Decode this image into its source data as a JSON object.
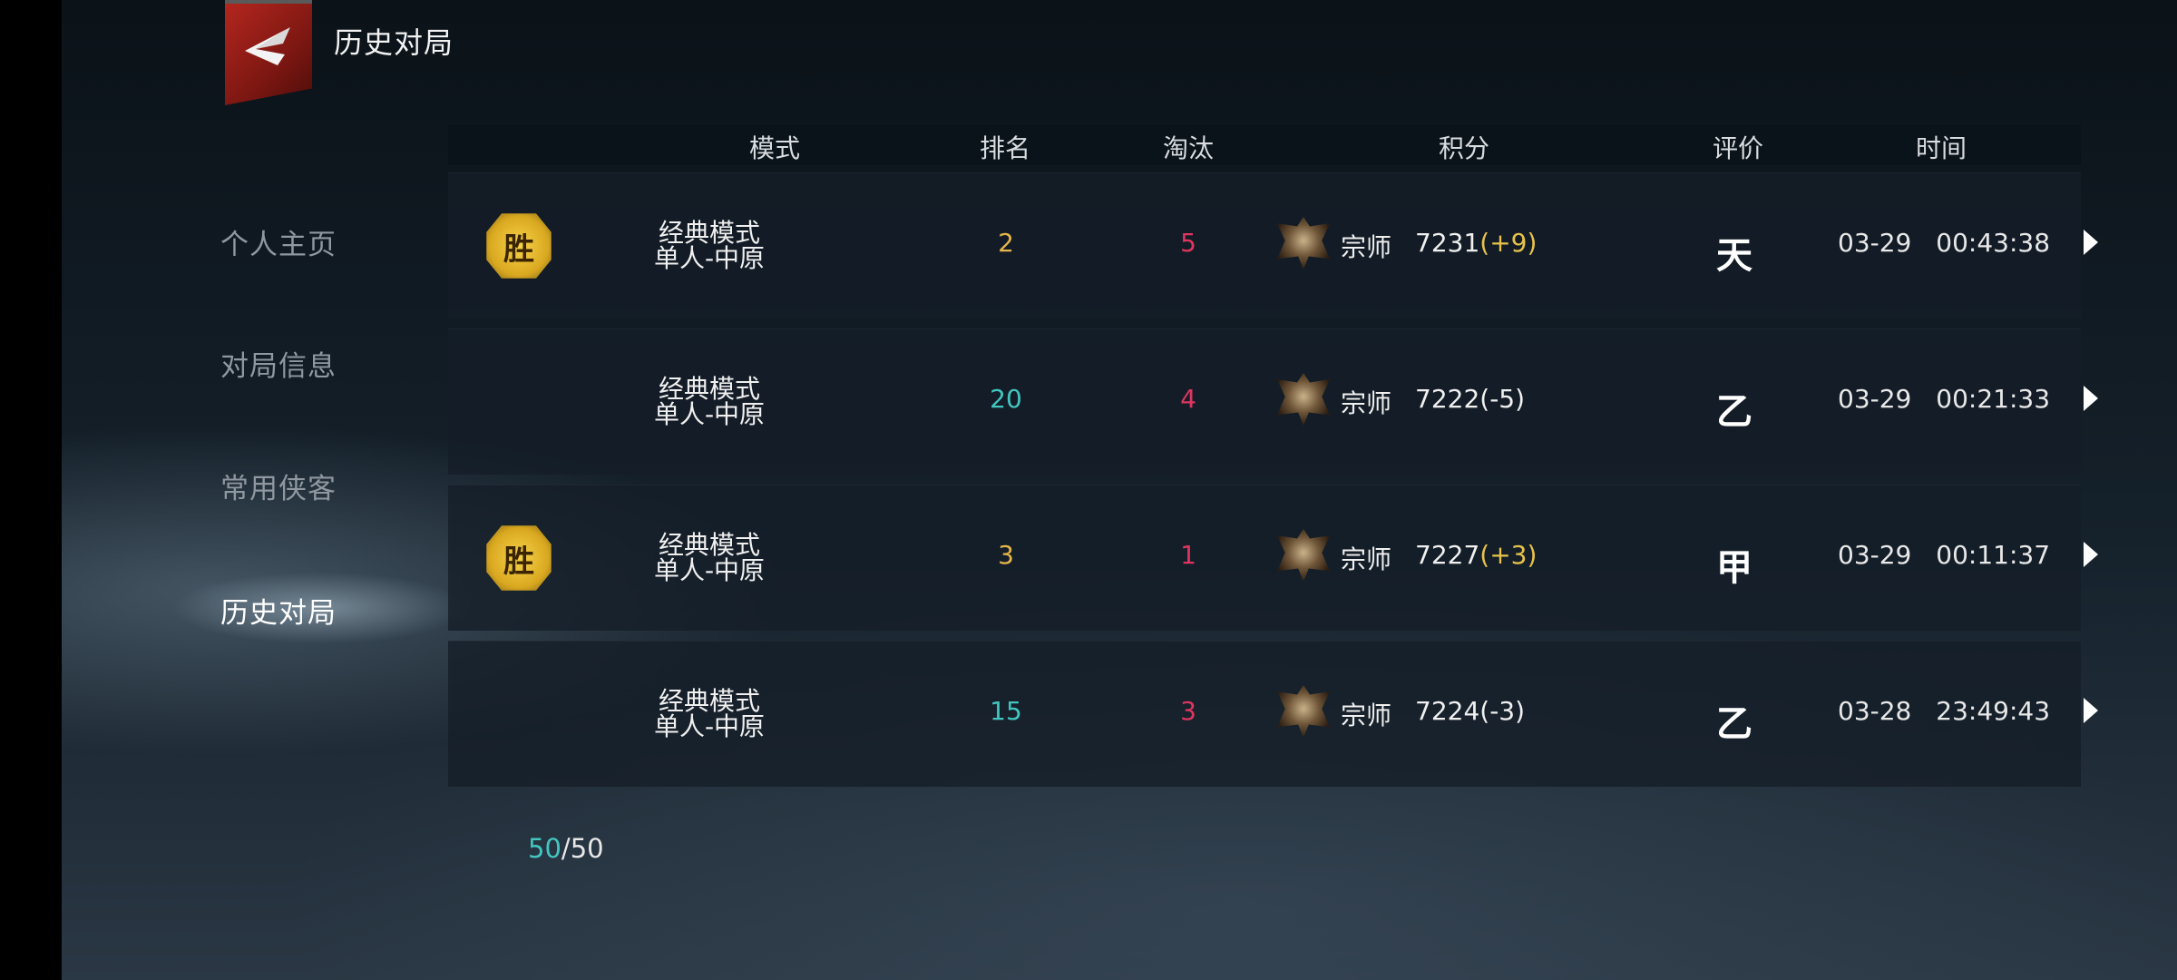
{
  "header": {
    "title": "历史对局",
    "back_icon": "back-arrow-icon"
  },
  "sidebar": {
    "items": [
      {
        "label": "个人主页",
        "active": false
      },
      {
        "label": "对局信息",
        "active": false
      },
      {
        "label": "常用侠客",
        "active": false
      },
      {
        "label": "历史对局",
        "active": true
      }
    ]
  },
  "table": {
    "columns": [
      "模式",
      "排名",
      "淘汰",
      "积分",
      "评价",
      "时间"
    ],
    "rows": [
      {
        "win": true,
        "win_label": "胜",
        "mode_line1": "经典模式",
        "mode_line2": "单人-中原",
        "rank": "2",
        "eliminations": "5",
        "tier": "宗师",
        "score": "7231",
        "delta": "(+9)",
        "grade": "天",
        "date": "03-29",
        "time": "00:43:38"
      },
      {
        "win": false,
        "win_label": "",
        "mode_line1": "经典模式",
        "mode_line2": "单人-中原",
        "rank": "20",
        "eliminations": "4",
        "tier": "宗师",
        "score": "7222",
        "delta": "(-5)",
        "grade": "乙",
        "date": "03-29",
        "time": "00:21:33"
      },
      {
        "win": true,
        "win_label": "胜",
        "mode_line1": "经典模式",
        "mode_line2": "单人-中原",
        "rank": "3",
        "eliminations": "1",
        "tier": "宗师",
        "score": "7227",
        "delta": "(+3)",
        "grade": "甲",
        "date": "03-29",
        "time": "00:11:37"
      },
      {
        "win": false,
        "win_label": "",
        "mode_line1": "经典模式",
        "mode_line2": "单人-中原",
        "rank": "15",
        "eliminations": "3",
        "tier": "宗师",
        "score": "7224",
        "delta": "(-3)",
        "grade": "乙",
        "date": "03-28",
        "time": "23:49:43"
      }
    ]
  },
  "pagination": {
    "current": "50",
    "separator": "/",
    "total": "50"
  },
  "colors": {
    "accent_teal": "#43c6c0",
    "gold": "#e7b54a",
    "elimination_red": "#e0355f",
    "back_red": "#b3261e"
  }
}
